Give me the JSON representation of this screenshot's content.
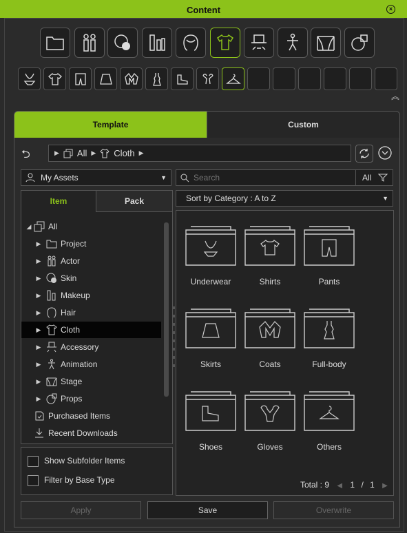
{
  "window": {
    "title": "Content",
    "close_icon": "close-circle-icon"
  },
  "categories": [
    {
      "name": "project",
      "icon": "folder-icon"
    },
    {
      "name": "actor",
      "icon": "actor-icon"
    },
    {
      "name": "skin",
      "icon": "skin-icon"
    },
    {
      "name": "makeup",
      "icon": "makeup-icon"
    },
    {
      "name": "hair",
      "icon": "hair-icon"
    },
    {
      "name": "cloth",
      "icon": "cloth-icon",
      "active": true
    },
    {
      "name": "accessory",
      "icon": "accessory-icon"
    },
    {
      "name": "animation",
      "icon": "animation-icon"
    },
    {
      "name": "stage",
      "icon": "stage-icon"
    },
    {
      "name": "props",
      "icon": "props-icon"
    }
  ],
  "subcategories": [
    {
      "name": "underwear",
      "icon": "underwear-icon"
    },
    {
      "name": "shirts",
      "icon": "shirt-icon"
    },
    {
      "name": "pants",
      "icon": "pants-icon"
    },
    {
      "name": "skirts",
      "icon": "skirt-icon"
    },
    {
      "name": "coats",
      "icon": "coat-icon"
    },
    {
      "name": "full-body",
      "icon": "dress-icon"
    },
    {
      "name": "shoes",
      "icon": "shoe-icon"
    },
    {
      "name": "gloves",
      "icon": "glove-icon"
    },
    {
      "name": "others",
      "icon": "hanger-icon",
      "active": true
    }
  ],
  "tabs": {
    "template": "Template",
    "custom": "Custom"
  },
  "breadcrumb": {
    "root": "All",
    "current": "Cloth"
  },
  "assets_select": {
    "value": "My Assets"
  },
  "search": {
    "placeholder": "Search",
    "filter_label": "All"
  },
  "sort": {
    "value": "Sort by Category : A to Z"
  },
  "left_tabs": {
    "item": "Item",
    "pack": "Pack"
  },
  "tree": {
    "root": "All",
    "items": [
      "Project",
      "Actor",
      "Skin",
      "Makeup",
      "Hair",
      "Cloth",
      "Accessory",
      "Animation",
      "Stage",
      "Props"
    ],
    "selected": "Cloth",
    "extra": [
      "Purchased Items",
      "Recent Downloads"
    ]
  },
  "grid_items": [
    "Underwear",
    "Shirts",
    "Pants",
    "Skirts",
    "Coats",
    "Full-body",
    "Shoes",
    "Gloves",
    "Others"
  ],
  "options": {
    "show_subfolder": "Show Subfolder Items",
    "filter_base": "Filter by Base Type"
  },
  "pager": {
    "total_label": "Total : 9",
    "page": "1",
    "sep": "/",
    "pages": "1"
  },
  "buttons": {
    "apply": "Apply",
    "save": "Save",
    "overwrite": "Overwrite"
  },
  "colors": {
    "accent": "#8cc21a",
    "panel": "#2b2b2b",
    "field": "#1e1e1e"
  }
}
